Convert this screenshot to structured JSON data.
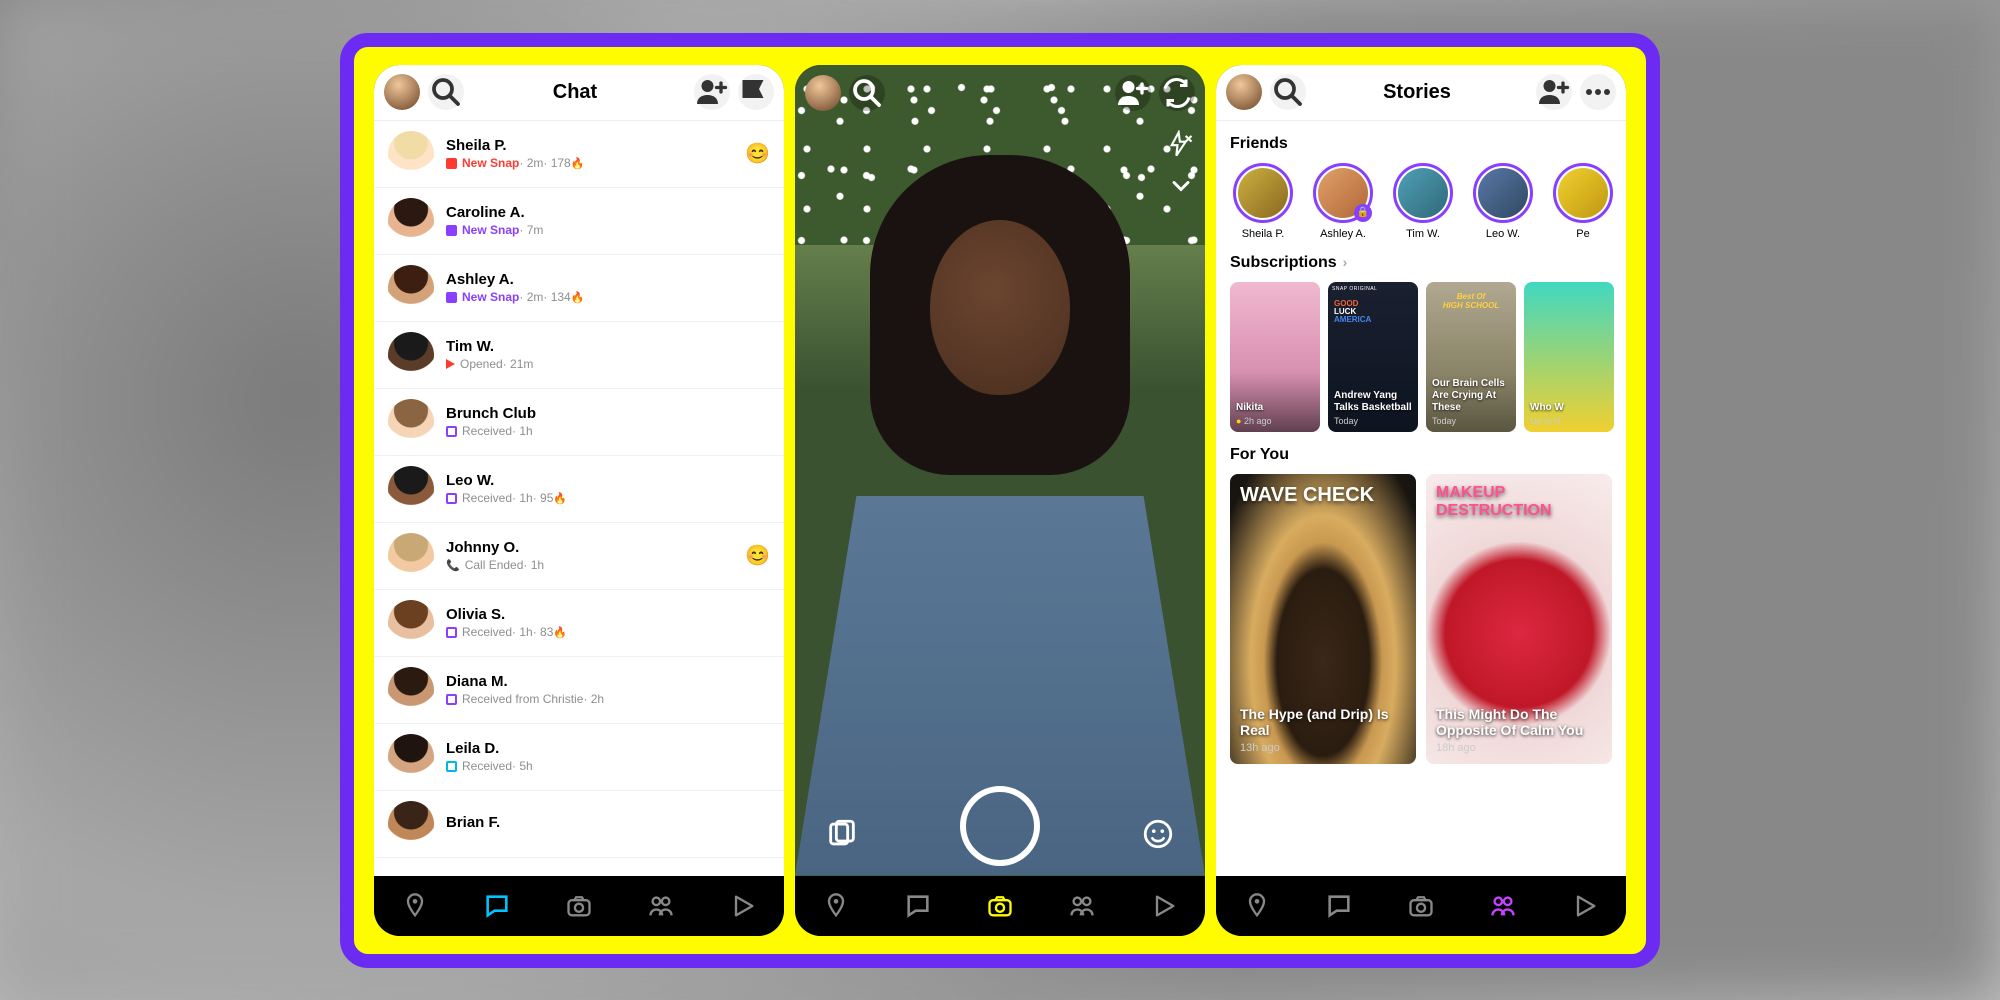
{
  "chat": {
    "title": "Chat",
    "items": [
      {
        "name": "Sheila P.",
        "status_label": "New Snap",
        "status_color": "#ff3b30",
        "time": "2m",
        "streak": "178",
        "fire": true,
        "emoji": "😊",
        "hair": "#f2dca6",
        "skin": "#ffe3c7",
        "box": true
      },
      {
        "name": "Caroline A.",
        "status_label": "New Snap",
        "status_color": "#8a3fff",
        "time": "7m",
        "hair": "#2b1810",
        "skin": "#e8b490",
        "box": true
      },
      {
        "name": "Ashley A.",
        "status_label": "New Snap",
        "status_color": "#8a3fff",
        "time": "2m",
        "streak": "134",
        "fire": true,
        "hair": "#3d1f12",
        "skin": "#d4a278",
        "box": true
      },
      {
        "name": "Tim W.",
        "status_label": "Opened",
        "status_color": "#ff3b30",
        "time": "21m",
        "hair": "#1a1a1a",
        "skin": "#5a3c28",
        "tri": true
      },
      {
        "name": "Brunch Club",
        "status_label": "Received",
        "status_color": "#8a3fff",
        "time": "1h",
        "hair": "#8b6542",
        "skin": "#f5d5b5",
        "outline": true
      },
      {
        "name": "Leo W.",
        "status_label": "Received",
        "status_color": "#8a3fff",
        "time": "1h",
        "streak": "95",
        "fire": true,
        "hair": "#1a1a1a",
        "skin": "#8b5a3c",
        "outline": true
      },
      {
        "name": "Johnny O.",
        "status_label": "Call Ended",
        "status_color": "#00c9a7",
        "time": "1h",
        "hair": "#c9a875",
        "skin": "#f2c9a0",
        "call": true,
        "emoji": "😊"
      },
      {
        "name": "Olivia S.",
        "status_label": "Received",
        "status_color": "#8a3fff",
        "time": "1h",
        "streak": "83",
        "fire": true,
        "hair": "#6b4020",
        "skin": "#e8c0a0",
        "outline": true
      },
      {
        "name": "Diana M.",
        "status_label": "Received from Christie",
        "status_color": "#8a3fff",
        "time": "2h",
        "hair": "#2a1a10",
        "skin": "#c99873",
        "outline": true
      },
      {
        "name": "Leila D.",
        "status_label": "Received",
        "status_color": "#00b8e6",
        "time": "5h",
        "hair": "#1f1410",
        "skin": "#d4a580",
        "chat_outline": true
      },
      {
        "name": "Brian F.",
        "status_label": "",
        "status_color": "#8a3fff",
        "time": "",
        "hair": "#3a2418",
        "skin": "#c08858"
      }
    ]
  },
  "stories": {
    "title": "Stories",
    "friends_header": "Friends",
    "friends": [
      {
        "name": "Sheila P.",
        "bg": "linear-gradient(135deg,#ccb040,#8a6820)"
      },
      {
        "name": "Ashley A.",
        "bg": "linear-gradient(135deg,#e0a068,#b06838)",
        "lock": true
      },
      {
        "name": "Tim W.",
        "bg": "linear-gradient(135deg,#50a0b8,#306878)"
      },
      {
        "name": "Leo W.",
        "bg": "linear-gradient(135deg,#5878a8,#304860)"
      },
      {
        "name": "Pe",
        "bg": "linear-gradient(135deg,#f0d030,#c09810)"
      }
    ],
    "subs_header": "Subscriptions",
    "subs": [
      {
        "title": "Nikita",
        "time": "2h ago",
        "bg": "linear-gradient(180deg,#f0b8d0,#d890b0 60%,#604050)",
        "badge": true
      },
      {
        "title": "Andrew Yang Talks Basketball",
        "time": "Today",
        "bg": "linear-gradient(180deg,#1a2030,#0d1420)",
        "overlay": "GOOD LUCK AMERICA",
        "snap": "SNAP ORIGINAL"
      },
      {
        "title": "Our Brain Cells Are Crying At These",
        "time": "Today",
        "bg": "linear-gradient(180deg,#b0a890,#8a8468 60%,#5a5640)",
        "overlay2": "HIGH SCHOOL"
      },
      {
        "title": "Who W",
        "time": "Up to N",
        "bg": "linear-gradient(180deg,#40d8c0,#f0d030)"
      }
    ],
    "foryou_header": "For You",
    "foryou": [
      {
        "head": "WAVE CHECK",
        "title": "The Hype (and Drip) Is Real",
        "time": "13h ago",
        "bg": "radial-gradient(ellipse at 50% 65%,#3a2818 0%,#2a1c10 35%,#c89850 45%,#d8ac60 55%,#181410 90%)"
      },
      {
        "head": "MAKEUP DESTRUCTION",
        "title": "This Might Do The Opposite Of Calm You",
        "time": "18h ago",
        "bg": "radial-gradient(circle at 50% 55%,#dc2840 0%,#c01828 40%,#f0d8d8 50%,#f8ecec 100%)",
        "pink": true
      }
    ]
  }
}
